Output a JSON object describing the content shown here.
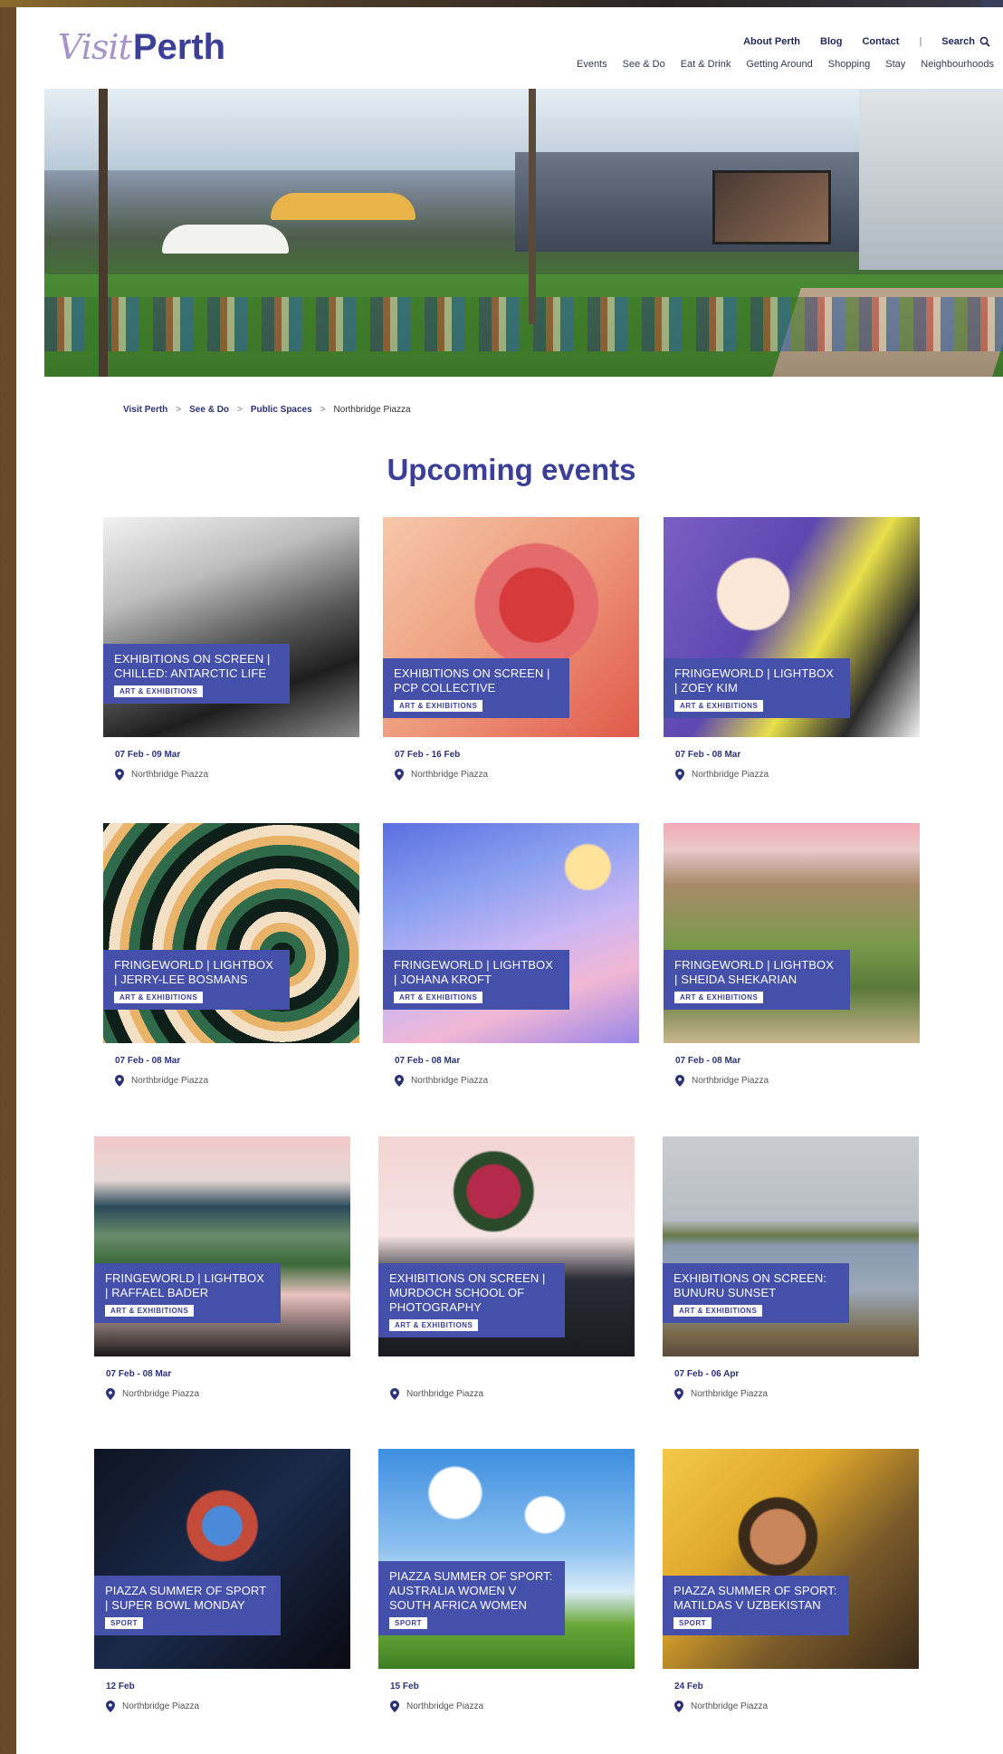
{
  "header": {
    "logo_visit": "Visit",
    "logo_perth": "Perth",
    "utility_nav": [
      "About Perth",
      "Blog",
      "Contact"
    ],
    "separator": "|",
    "search_label": "Search",
    "main_nav": [
      "Events",
      "See & Do",
      "Eat & Drink",
      "Getting Around",
      "Shopping",
      "Stay",
      "Neighbourhoods"
    ]
  },
  "breadcrumb": [
    "Visit Perth",
    "See & Do",
    "Public Spaces",
    "Northbridge Piazza"
  ],
  "breadcrumb_separator": ">",
  "section_title": "Upcoming events",
  "cards": [
    {
      "title": "EXHIBITIONS ON SCREEN | CHILLED: ANTARCTIC LIFE",
      "tag": "ART & EXHIBITIONS",
      "date": "07 Feb - 09 Mar",
      "location": "Northbridge Piazza"
    },
    {
      "title": "EXHIBITIONS ON SCREEN | PCP COLLECTIVE",
      "tag": "ART & EXHIBITIONS",
      "date": "07 Feb - 16 Feb",
      "location": "Northbridge Piazza"
    },
    {
      "title": "FRINGEWORLD | LIGHTBOX | ZOEY KIM",
      "tag": "ART & EXHIBITIONS",
      "date": "07 Feb - 08 Mar",
      "location": "Northbridge Piazza"
    },
    {
      "title": "FRINGEWORLD | LIGHTBOX | JERRY-LEE BOSMANS",
      "tag": "ART & EXHIBITIONS",
      "date": "07 Feb - 08 Mar",
      "location": "Northbridge Piazza"
    },
    {
      "title": "FRINGEWORLD | LIGHTBOX | JOHANA KROFT",
      "tag": "ART & EXHIBITIONS",
      "date": "07 Feb - 08 Mar",
      "location": "Northbridge Piazza"
    },
    {
      "title": "FRINGEWORLD | LIGHTBOX | SHEIDA SHEKARIAN",
      "tag": "ART & EXHIBITIONS",
      "date": "07 Feb - 08 Mar",
      "location": "Northbridge Piazza"
    },
    {
      "title": "FRINGEWORLD | LIGHTBOX | RAFFAEL BADER",
      "tag": "ART & EXHIBITIONS",
      "date": "07 Feb - 08 Mar",
      "location": "Northbridge Piazza"
    },
    {
      "title": "EXHIBITIONS ON SCREEN | MURDOCH SCHOOL OF PHOTOGRAPHY",
      "tag": "ART & EXHIBITIONS",
      "date": "",
      "location": "Northbridge Piazza"
    },
    {
      "title": "EXHIBITIONS ON SCREEN: BUNURU SUNSET",
      "tag": "ART & EXHIBITIONS",
      "date": "07 Feb - 06 Apr",
      "location": "Northbridge Piazza"
    },
    {
      "title": "PIAZZA SUMMER OF SPORT | SUPER BOWL MONDAY",
      "tag": "SPORT",
      "date": "12 Feb",
      "location": "Northbridge Piazza"
    },
    {
      "title": "PIAZZA SUMMER OF SPORT: AUSTRALIA WOMEN V SOUTH AFRICA WOMEN",
      "tag": "SPORT",
      "date": "15 Feb",
      "location": "Northbridge Piazza"
    },
    {
      "title": "PIAZZA SUMMER OF SPORT: MATILDAS V UZBEKISTAN",
      "tag": "SPORT",
      "date": "24 Feb",
      "location": "Northbridge Piazza"
    }
  ],
  "colors": {
    "brand": "#3b3f98",
    "overlay": "#4450a9",
    "logo_script": "#a593c9"
  },
  "icons": {
    "search": "search-icon",
    "location": "map-pin-icon"
  }
}
